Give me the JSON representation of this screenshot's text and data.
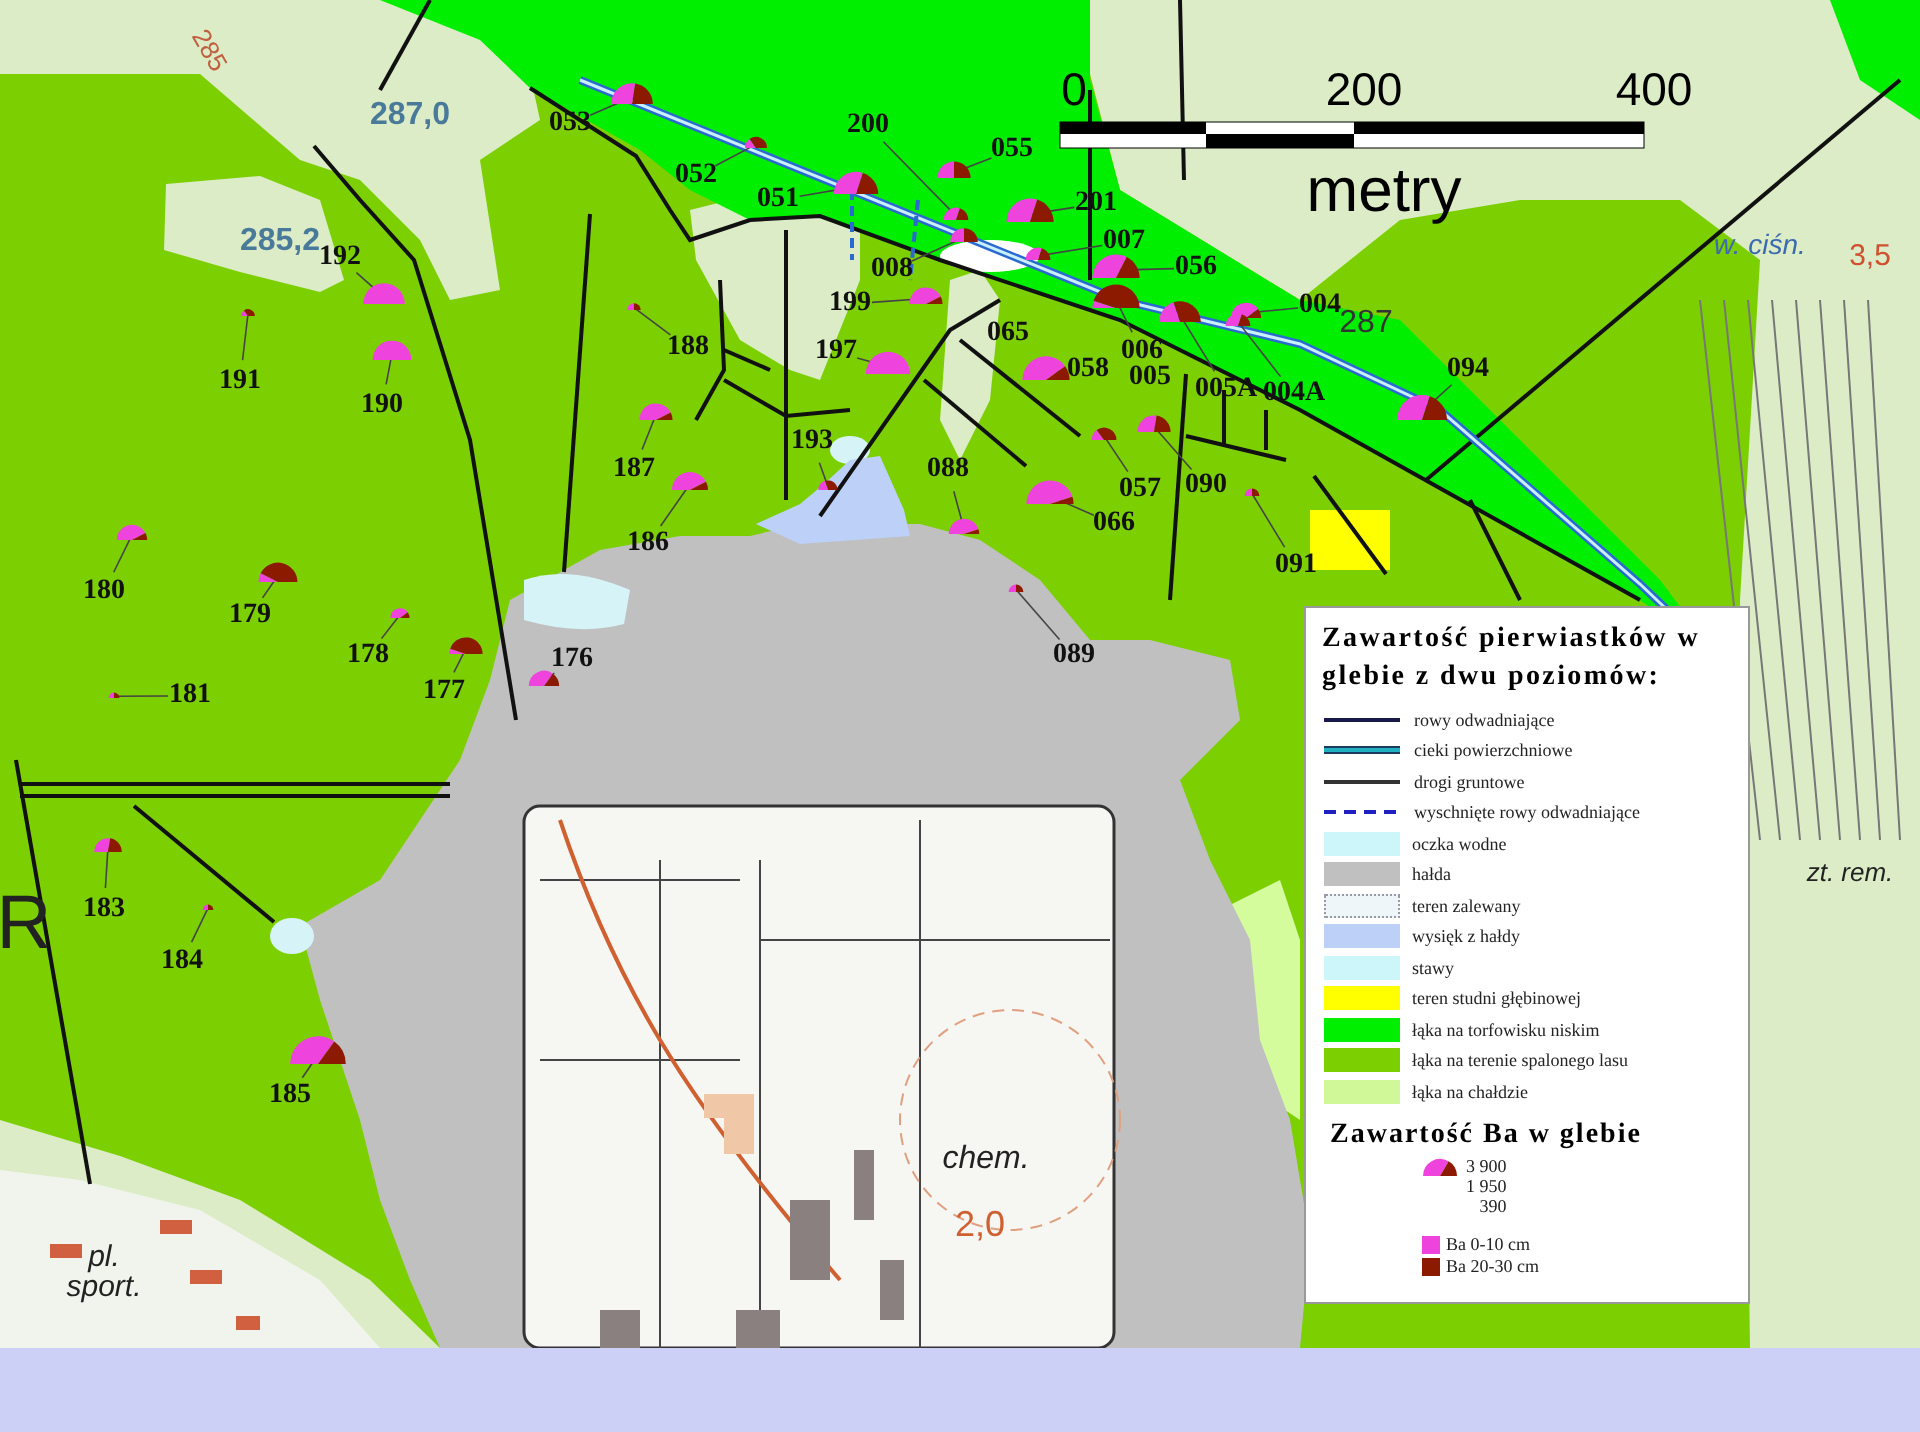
{
  "scale_bar": {
    "ticks": [
      "0",
      "200",
      "400"
    ],
    "unit": "metry"
  },
  "map_labels": [
    {
      "text": "285"
    },
    {
      "text": "287,0"
    },
    {
      "text": "285,2"
    },
    {
      "text": "w. ciśn."
    },
    {
      "text": "3,5"
    },
    {
      "text": "287"
    },
    {
      "text": "R"
    },
    {
      "text": "zt. rem."
    },
    {
      "text": "chem."
    },
    {
      "text": "2,0"
    },
    {
      "text": "pl. sport."
    }
  ],
  "sample_points": [
    {
      "label": "053"
    },
    {
      "label": "200"
    },
    {
      "label": "055"
    },
    {
      "label": "052"
    },
    {
      "label": "051"
    },
    {
      "label": "201"
    },
    {
      "label": "007"
    },
    {
      "label": "008"
    },
    {
      "label": "056"
    },
    {
      "label": "192"
    },
    {
      "label": "199"
    },
    {
      "label": "004"
    },
    {
      "label": "006"
    },
    {
      "label": "065"
    },
    {
      "label": "188"
    },
    {
      "label": "197"
    },
    {
      "label": "058"
    },
    {
      "label": "005"
    },
    {
      "label": "190"
    },
    {
      "label": "191"
    },
    {
      "label": "005A"
    },
    {
      "label": "004A"
    },
    {
      "label": "094"
    },
    {
      "label": "193"
    },
    {
      "label": "187"
    },
    {
      "label": "088"
    },
    {
      "label": "057"
    },
    {
      "label": "090"
    },
    {
      "label": "066"
    },
    {
      "label": "186"
    },
    {
      "label": "091"
    },
    {
      "label": "180"
    },
    {
      "label": "179"
    },
    {
      "label": "178"
    },
    {
      "label": "176"
    },
    {
      "label": "089"
    },
    {
      "label": "177"
    },
    {
      "label": "181"
    },
    {
      "label": "183"
    },
    {
      "label": "184"
    },
    {
      "label": "185"
    }
  ],
  "legend": {
    "title": "Zawartość pierwiastków w glebie z dwu poziomów:",
    "items": [
      {
        "kind": "line",
        "color": "#1a1a4a",
        "label": "rowy odwadniające"
      },
      {
        "kind": "double-line",
        "color": "#20b0c0",
        "label": "cieki powierzchniowe"
      },
      {
        "kind": "line",
        "color": "#333333",
        "label": "drogi gruntowe"
      },
      {
        "kind": "dashed-line",
        "color": "#2020c0",
        "label": "wyschnięte rowy odwadniające"
      },
      {
        "kind": "swatch",
        "color": "#ccf6fa",
        "label": "oczka wodne"
      },
      {
        "kind": "swatch",
        "color": "#c0c0c0",
        "label": "hałda"
      },
      {
        "kind": "dotted-swatch",
        "color": "#eef6fa",
        "label": "teren zalewany"
      },
      {
        "kind": "swatch",
        "color": "#bcd0f8",
        "label": "wysięk z hałdy"
      },
      {
        "kind": "swatch",
        "color": "#ccf6fa",
        "label": "stawy"
      },
      {
        "kind": "swatch",
        "color": "#ffff00",
        "label": "teren studni głębinowej"
      },
      {
        "kind": "swatch",
        "color": "#00ee00",
        "label": "łąka na torfowisku niskim"
      },
      {
        "kind": "swatch",
        "color": "#7ccf00",
        "label": "łąka na terenie spalonego lasu"
      },
      {
        "kind": "swatch",
        "color": "#d0f898",
        "label": "łąka na chałdzie"
      }
    ],
    "ba_title": "Zawartość Ba w glebie",
    "scale_values": [
      "3 900",
      "1 950",
      "390"
    ],
    "entries": [
      {
        "label": "Ba 0-10 cm",
        "color": "#ee44dd"
      },
      {
        "label": "Ba 20-30 cm",
        "color": "#8b1a00"
      }
    ]
  }
}
